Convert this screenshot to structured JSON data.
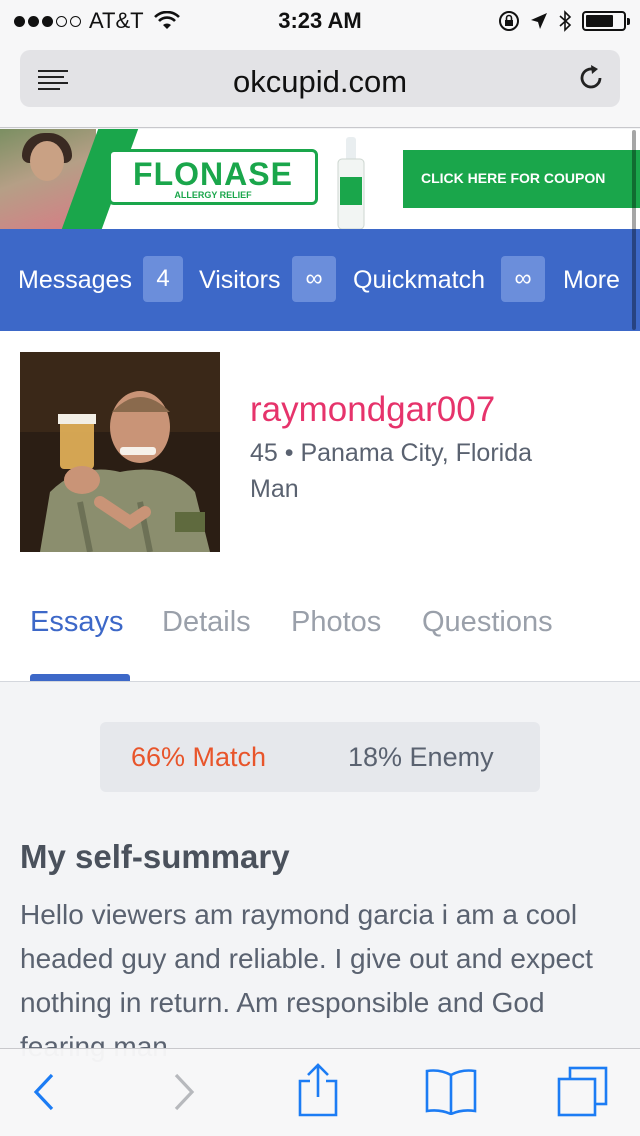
{
  "status_bar": {
    "carrier": "AT&T",
    "time": "3:23 AM",
    "signal_bars_filled": 3,
    "signal_bars_total": 5,
    "battery_level": 0.75,
    "icons": [
      "wifi-icon",
      "orientation-lock-icon",
      "location-arrow-icon",
      "bluetooth-icon",
      "battery-icon"
    ]
  },
  "browser": {
    "url": "okcupid.com",
    "icons": [
      "reader-list-icon",
      "reload-icon"
    ]
  },
  "ad": {
    "brand": "FLONASE",
    "tagline": "ALLERGY RELIEF",
    "cta": "CLICK HERE FOR COUPON",
    "accent_color": "#1aa64b"
  },
  "nav": {
    "messages_label": "Messages",
    "messages_count": "4",
    "visitors_label": "Visitors",
    "visitors_count": "∞",
    "quickmatch_label": "Quickmatch",
    "quickmatch_count": "∞",
    "more_label": "More",
    "color": "#3d68c8"
  },
  "profile": {
    "username": "raymondgar007",
    "age_location": "45 • Panama City, Florida",
    "gender": "Man",
    "username_color": "#e6336b"
  },
  "tabs": {
    "essays": "Essays",
    "details": "Details",
    "photos": "Photos",
    "questions": "Questions",
    "active": "Essays"
  },
  "match": {
    "match_text": "66% Match",
    "enemy_text": "18% Enemy",
    "match_color": "#e8552b"
  },
  "essay": {
    "title": "My self-summary",
    "text": "Hello viewers am raymond garcia i am a cool headed guy and reliable. I give out and expect nothing in return. Am responsible and God fearing man"
  },
  "toolbar": {
    "icons": [
      "back-icon",
      "forward-icon",
      "share-icon",
      "bookmarks-icon",
      "tabs-icon"
    ]
  }
}
